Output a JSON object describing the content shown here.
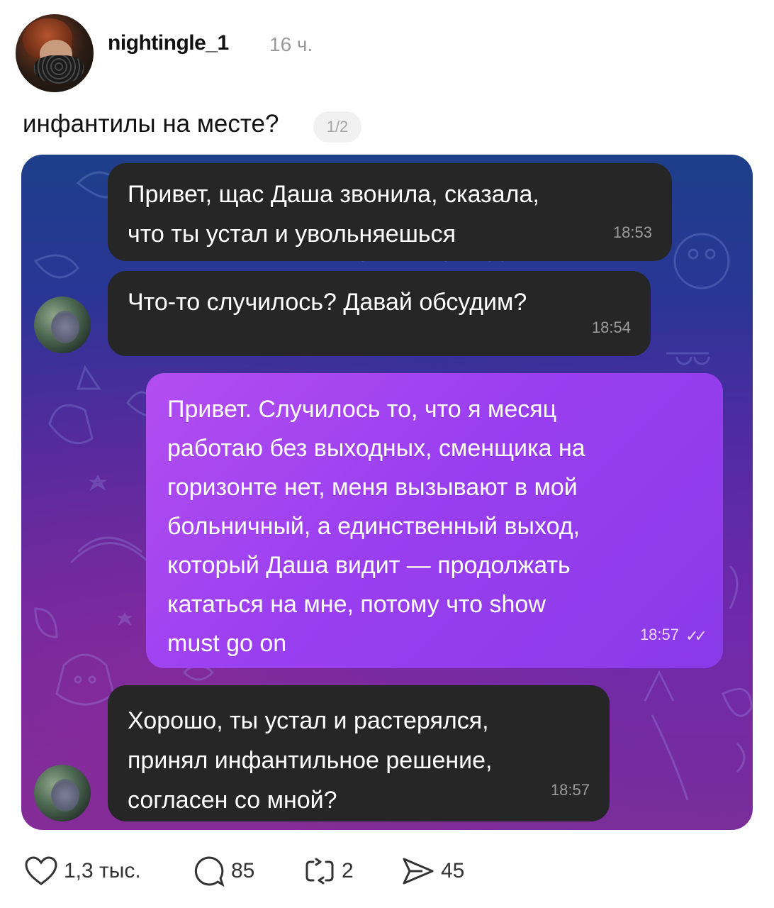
{
  "post": {
    "username": "nightingle_1",
    "time": "16 ч.",
    "text": "инфантилы на месте?",
    "page_indicator": "1/2"
  },
  "chat": {
    "messages": [
      {
        "direction": "incoming",
        "text": "Привет, щас Даша звонила, сказала,\nчто ты устал и увольняешься",
        "time": "18:53"
      },
      {
        "direction": "incoming",
        "text": "Что-то случилось? Давай обсудим?",
        "time": "18:54"
      },
      {
        "direction": "outgoing",
        "text": "Привет. Случилось то, что я месяц\nработаю без выходных, сменщика на\nгоризонте нет, меня вызывают в мой\nбольничный, а единственный выход,\nкоторый Даша видит — продолжать\nкататься на мне, потому что show\nmust go on",
        "time": "18:57",
        "status_icon": "double-check-icon"
      },
      {
        "direction": "incoming",
        "text": "Хорошо, ты устал и растерялся,\nпринял инфантильное решение,\nсогласен со мной?",
        "time": "18:57"
      }
    ],
    "colors": {
      "incoming_bubble": "#262626",
      "outgoing_bubble": "#9a3ff0",
      "background_top": "#1d3f8a",
      "background_bottom": "#7a2f92"
    }
  },
  "actions": {
    "likes": "1,3 тыс.",
    "comments": "85",
    "reposts": "2",
    "shares": "45",
    "icons": [
      "heart-icon",
      "comment-icon",
      "repost-icon",
      "share-icon"
    ]
  }
}
